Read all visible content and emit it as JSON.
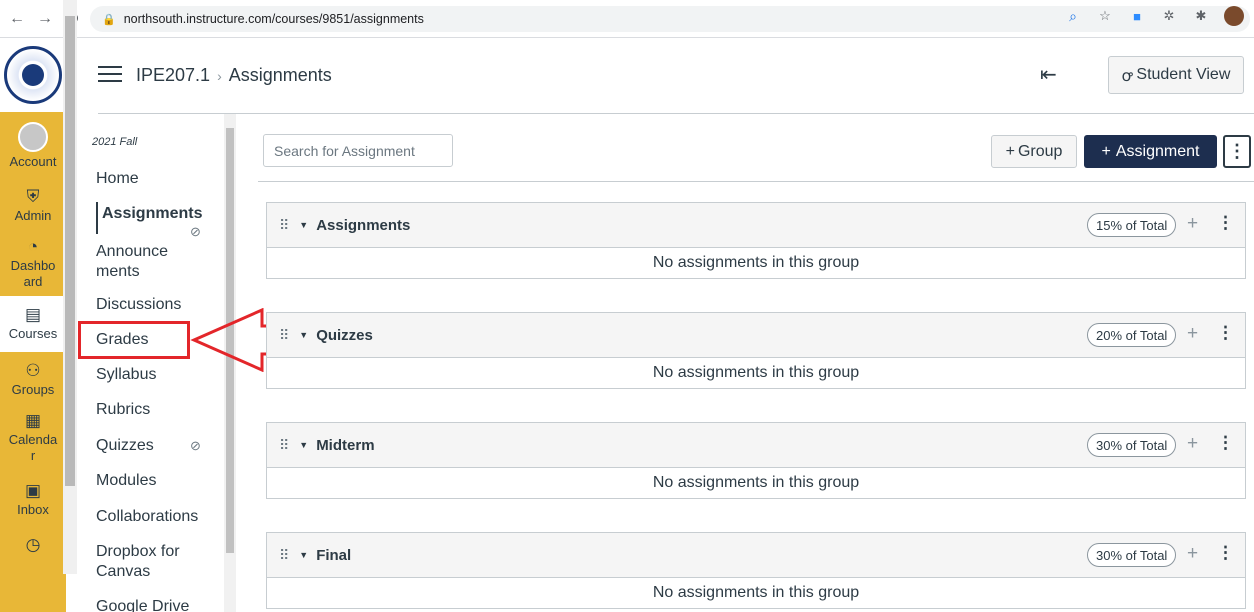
{
  "browser": {
    "url": "northsouth.instructure.com/courses/9851/assignments"
  },
  "global_nav": {
    "items": [
      {
        "label": "Account",
        "icon": "avatar-icon"
      },
      {
        "label": "Admin",
        "icon": "shield-icon"
      },
      {
        "label": "Dashbo\nard",
        "icon": "dashboard-icon"
      },
      {
        "label": "Courses",
        "icon": "book-icon"
      },
      {
        "label": "Groups",
        "icon": "groups-icon"
      },
      {
        "label": "Calenda\nr",
        "icon": "calendar-icon"
      },
      {
        "label": "Inbox",
        "icon": "inbox-icon"
      }
    ]
  },
  "header": {
    "course": "IPE207.1",
    "separator": "›",
    "page": "Assignments",
    "student_view": "Student View"
  },
  "course_nav": {
    "term": "2021 Fall",
    "items": [
      "Home",
      "Assignments",
      "Announce\nments",
      "Discussions",
      "Grades",
      "Syllabus",
      "Rubrics",
      "Quizzes",
      "Modules",
      "Collaborations",
      "Dropbox for Canvas",
      "Google Drive"
    ]
  },
  "toolbar": {
    "search_placeholder": "Search for Assignment",
    "group_button": "Group",
    "assignment_button": "Assignment"
  },
  "groups": [
    {
      "name": "Assignments",
      "weight": "15% of Total",
      "empty": "No assignments in this group"
    },
    {
      "name": "Quizzes",
      "weight": "20% of Total",
      "empty": "No assignments in this group"
    },
    {
      "name": "Midterm",
      "weight": "30% of Total",
      "empty": "No assignments in this group"
    },
    {
      "name": "Final",
      "weight": "30% of Total",
      "empty": "No assignments in this group"
    }
  ],
  "colors": {
    "global_nav": "#e8b737",
    "primary_button": "#1d2e4f",
    "annotation": "#e3262a"
  }
}
